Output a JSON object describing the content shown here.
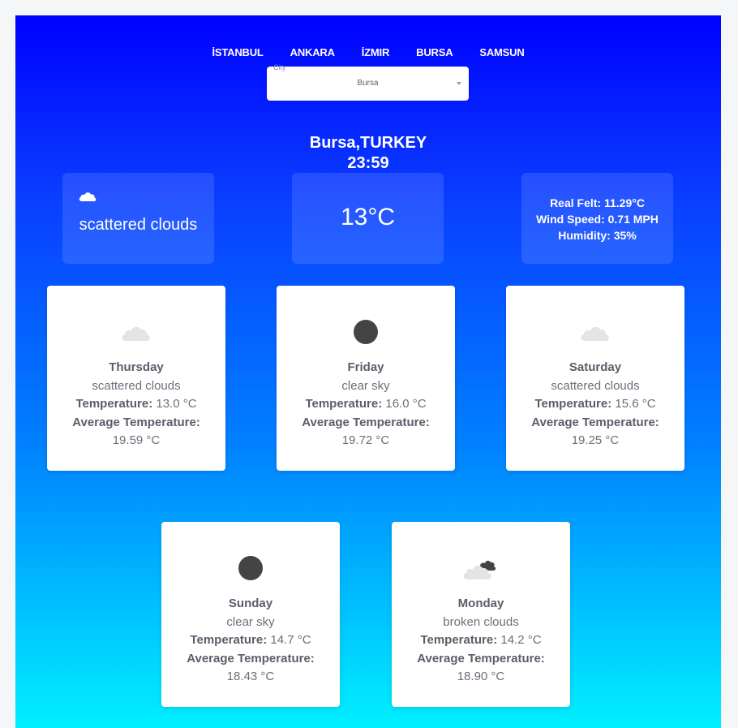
{
  "nav": [
    "İSTANBUL",
    "ANKARA",
    "İZMIR",
    "BURSA",
    "SAMSUN"
  ],
  "select": {
    "label": "City",
    "value": "Bursa"
  },
  "location": {
    "city_country": "Bursa,TURKEY",
    "time": "23:59"
  },
  "current": {
    "icon": "cloud-icon",
    "description": "scattered clouds",
    "temperature": "13°C",
    "real_felt": "Real Felt: 11.29°C",
    "wind_speed": "Wind Speed: 0.71 MPH",
    "humidity": "Humidity: 35%"
  },
  "labels": {
    "temperature": "Temperature:",
    "average": "Average Temperature:"
  },
  "forecast": [
    {
      "day": "Thursday",
      "icon": "scattered-clouds-icon",
      "description": "scattered clouds",
      "temp": "13.0 °C",
      "avg": "19.59 °C"
    },
    {
      "day": "Friday",
      "icon": "clear-sky-icon",
      "description": "clear sky",
      "temp": "16.0 °C",
      "avg": "19.72 °C"
    },
    {
      "day": "Saturday",
      "icon": "scattered-clouds-icon",
      "description": "scattered clouds",
      "temp": "15.6 °C",
      "avg": "19.25 °C"
    },
    {
      "day": "Sunday",
      "icon": "clear-sky-icon",
      "description": "clear sky",
      "temp": "14.7 °C",
      "avg": "18.43 °C"
    },
    {
      "day": "Monday",
      "icon": "broken-clouds-icon",
      "description": "broken clouds",
      "temp": "14.2 °C",
      "avg": "18.90 °C"
    }
  ],
  "colors": {
    "gradient_top": "#0000ff",
    "gradient_bottom": "#00f0ff",
    "icon_dark": "#444444",
    "icon_light": "#e4e4e4"
  }
}
